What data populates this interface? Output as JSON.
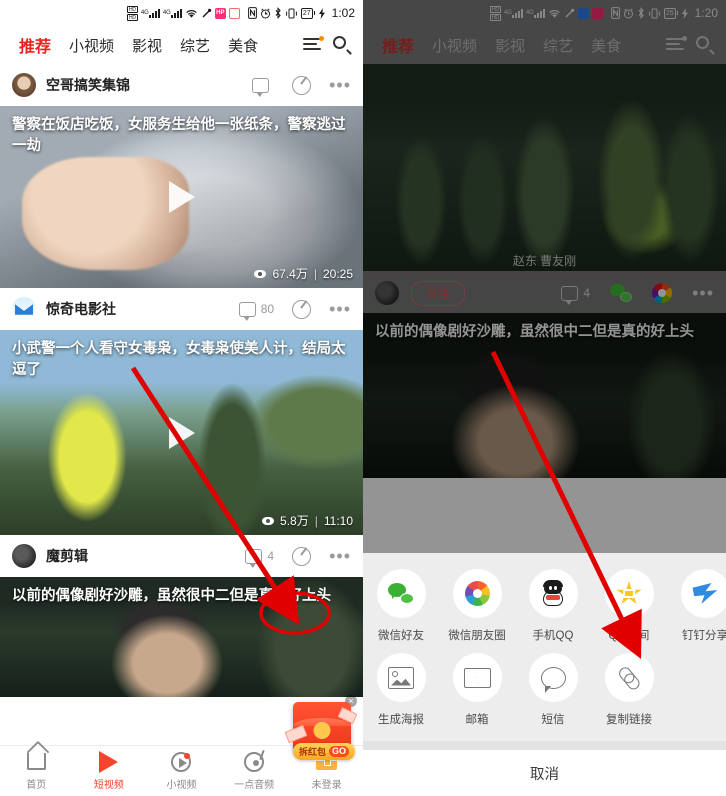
{
  "left": {
    "status": {
      "battery": "27",
      "time": "1:02",
      "net1": "4G",
      "net2": "4G",
      "hd": "HD"
    },
    "tabs": [
      {
        "label": "推荐",
        "active": true
      },
      {
        "label": "小视频",
        "active": false
      },
      {
        "label": "影视",
        "active": false
      },
      {
        "label": "综艺",
        "active": false
      },
      {
        "label": "美食",
        "active": false
      }
    ],
    "menu_icon": "hamburger-menu-icon",
    "search_icon": "search-icon",
    "cards": [
      {
        "channel": "空哥搞笑集锦",
        "comments": "",
        "title": "警察在饭店吃饭，女服务生给他一张纸条，警察逃过一劫",
        "views": "67.4万",
        "duration": "20:25"
      },
      {
        "channel": "惊奇电影社",
        "comments": "80",
        "title": "小武警一个人看守女毒枭，女毒枭使美人计，结局太逗了",
        "views": "5.8万",
        "duration": "11:10"
      },
      {
        "channel": "魔剪辑",
        "comments": "4",
        "title": "以前的偶像剧好沙雕，虽然很中二但是真的好上头",
        "views": "",
        "duration": ""
      }
    ],
    "redpacket": {
      "label": "拆红包",
      "go": "GO",
      "close": "×"
    },
    "bottomnav": [
      {
        "label": "首页",
        "icon": "home-icon",
        "active": false,
        "badge": false
      },
      {
        "label": "短视频",
        "icon": "play-triangle-icon",
        "active": true,
        "badge": false
      },
      {
        "label": "小视频",
        "icon": "video-circle-icon",
        "active": false,
        "badge": true
      },
      {
        "label": "一点音频",
        "icon": "audio-disc-icon",
        "active": false,
        "badge": false
      },
      {
        "label": "未登录",
        "icon": "treasure-box-icon",
        "active": false,
        "badge": false
      }
    ]
  },
  "right": {
    "status": {
      "battery": "25",
      "time": "1:20",
      "net1": "4G",
      "net2": "4G",
      "hd": "HD"
    },
    "tabs": [
      {
        "label": "推荐",
        "active": true
      },
      {
        "label": "小视频",
        "active": false
      },
      {
        "label": "影视",
        "active": false
      },
      {
        "label": "综艺",
        "active": false
      },
      {
        "label": "美食",
        "active": false
      }
    ],
    "video_credit": "赵东  曹友刚",
    "actionbar": {
      "follow": "关注",
      "comments": "4",
      "wechat_icon": "wechat-icon",
      "moments_icon": "wechat-moments-icon",
      "more_icon": "more-dots-icon"
    },
    "next_title": "以前的偶像剧好沙雕，虽然很中二但是真的好上头",
    "share_sheet": {
      "row1": [
        {
          "label": "微信好友",
          "icon": "wechat-icon"
        },
        {
          "label": "微信朋友圈",
          "icon": "wechat-moments-icon"
        },
        {
          "label": "手机QQ",
          "icon": "qq-penguin-icon"
        },
        {
          "label": "QQ空间",
          "icon": "qzone-star-icon"
        },
        {
          "label": "钉钉分享",
          "icon": "dingtalk-icon"
        }
      ],
      "row2": [
        {
          "label": "生成海报",
          "icon": "image-poster-icon"
        },
        {
          "label": "邮箱",
          "icon": "mail-envelope-icon"
        },
        {
          "label": "短信",
          "icon": "sms-bubble-icon"
        },
        {
          "label": "复制链接",
          "icon": "link-chain-icon"
        }
      ],
      "cancel": "取消"
    }
  },
  "annotations": {
    "arrow1": "red-arrow-pointing-to-share-button",
    "ellipse1": "red-ellipse-highlighting-share-button",
    "arrow2": "red-arrow-pointing-to-copy-link"
  },
  "colors": {
    "accent_red": "#e8231f",
    "nav_active": "#f4442e",
    "annotation_red": "#e00000",
    "wechat_green": "#3cb034",
    "sheet_bg": "#ededed"
  }
}
